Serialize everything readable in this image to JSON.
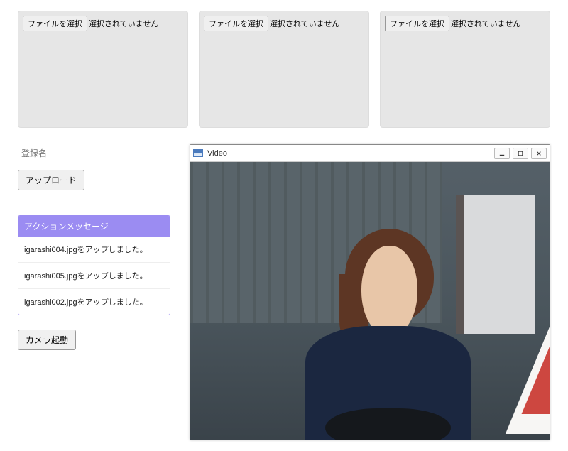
{
  "fileSlots": [
    {
      "buttonLabel": "ファイルを選択",
      "status": "選択されていません"
    },
    {
      "buttonLabel": "ファイルを選択",
      "status": "選択されていません"
    },
    {
      "buttonLabel": "ファイルを選択",
      "status": "選択されていません"
    }
  ],
  "registerName": {
    "placeholder": "登録名"
  },
  "buttons": {
    "upload": "アップロード",
    "camera": "カメラ起動"
  },
  "actionMessages": {
    "header": "アクションメッセージ",
    "items": [
      "igarashi004.jpgをアップしました。",
      "igarashi005.jpgをアップしました。",
      "igarashi002.jpgをアップしました。"
    ]
  },
  "videoWindow": {
    "title": "Video"
  }
}
